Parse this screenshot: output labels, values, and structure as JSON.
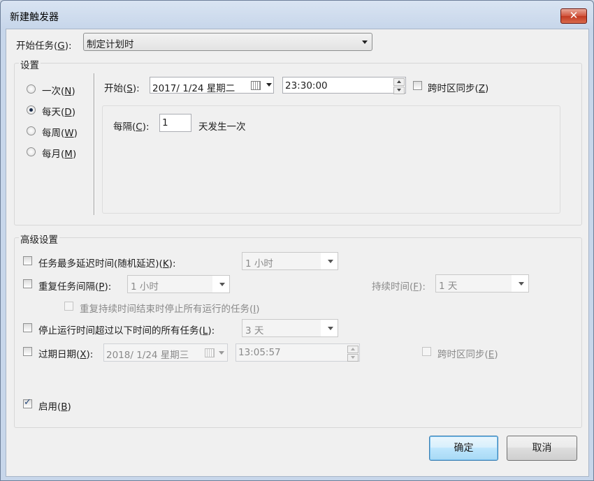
{
  "window": {
    "title": "新建触发器",
    "close_glyph": "✕"
  },
  "begin_task": {
    "label_prefix": "开始任务(",
    "label_key": "G",
    "label_suffix": "):",
    "value": "制定计划时"
  },
  "settings": {
    "group_label": "设置",
    "radios": [
      {
        "prefix": "一次(",
        "key": "N",
        "suffix": ")",
        "checked": false
      },
      {
        "prefix": "每天(",
        "key": "D",
        "suffix": ")",
        "checked": true
      },
      {
        "prefix": "每周(",
        "key": "W",
        "suffix": ")",
        "checked": false
      },
      {
        "prefix": "每月(",
        "key": "M",
        "suffix": ")",
        "checked": false
      }
    ],
    "start_label_prefix": "开始(",
    "start_label_key": "S",
    "start_label_suffix": "):",
    "start_date": "2017/  1/24 星期二",
    "start_time": "23:30:00",
    "sync_tz_prefix": "跨时区同步(",
    "sync_tz_key": "Z",
    "sync_tz_suffix": ")",
    "sync_tz_checked": false,
    "recur_label_prefix": "每隔(",
    "recur_label_key": "C",
    "recur_label_suffix": "):",
    "recur_value": "1",
    "recur_unit": "天发生一次"
  },
  "advanced": {
    "group_label": "高级设置",
    "delay": {
      "prefix": "任务最多延迟时间(随机延迟)(",
      "key": "K",
      "suffix": "):",
      "value": "1 小时",
      "checked": false
    },
    "repeat": {
      "prefix": "重复任务间隔(",
      "key": "P",
      "suffix": "):",
      "value": "1 小时",
      "checked": false,
      "duration_prefix": "持续时间(",
      "duration_key": "F",
      "duration_suffix": "):",
      "duration_value": "1 天"
    },
    "stop_at_end": {
      "prefix": "重复持续时间结束时停止所有运行的任务(",
      "key": "I",
      "suffix": ")",
      "checked": false
    },
    "stop_longer": {
      "prefix": "停止运行时间超过以下时间的所有任务(",
      "key": "L",
      "suffix": "):",
      "value": "3 天",
      "checked": false
    },
    "expire": {
      "prefix": "过期日期(",
      "key": "X",
      "suffix": "):",
      "date": "2018/  1/24 星期三",
      "time": "13:05:57",
      "checked": false,
      "sync_prefix": "跨时区同步(",
      "sync_key": "E",
      "sync_suffix": ")"
    },
    "enabled": {
      "prefix": "启用(",
      "key": "B",
      "suffix": ")",
      "checked": true
    }
  },
  "buttons": {
    "ok": "确定",
    "cancel": "取消"
  }
}
